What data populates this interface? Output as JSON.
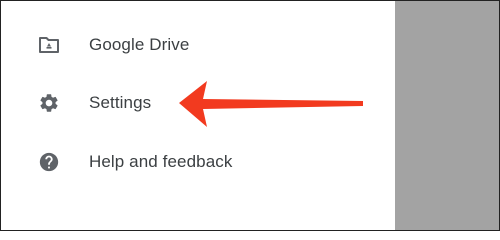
{
  "menu": {
    "items": [
      {
        "label": "Google Drive",
        "icon": "folder-drive-icon"
      },
      {
        "label": "Settings",
        "icon": "gear-icon"
      },
      {
        "label": "Help and feedback",
        "icon": "help-icon"
      }
    ]
  },
  "annotation": {
    "icon": "red-arrow-icon",
    "color": "#f23a1f"
  },
  "colors": {
    "icon": "#5f6368",
    "text": "#3c4043",
    "scrim": "#a3a3a3"
  }
}
